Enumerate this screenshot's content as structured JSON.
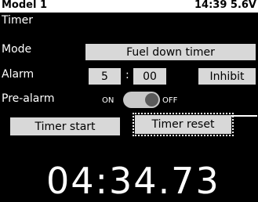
{
  "header": {
    "model": "Model 1",
    "time": "14:39",
    "voltage": "5.6V"
  },
  "screen": {
    "title": "Timer"
  },
  "rows": {
    "mode": {
      "label": "Mode",
      "value": "Fuel down timer"
    },
    "alarm": {
      "label": "Alarm",
      "minutes": "5",
      "colon": ":",
      "seconds": "00",
      "action": "Inhibit"
    },
    "prealarm": {
      "label": "Pre-alarm",
      "on_label": "ON",
      "off_label": "OFF",
      "state": "OFF"
    }
  },
  "buttons": {
    "start": "Timer start",
    "reset": "Timer reset"
  },
  "timer": {
    "display": "04:34.73"
  }
}
